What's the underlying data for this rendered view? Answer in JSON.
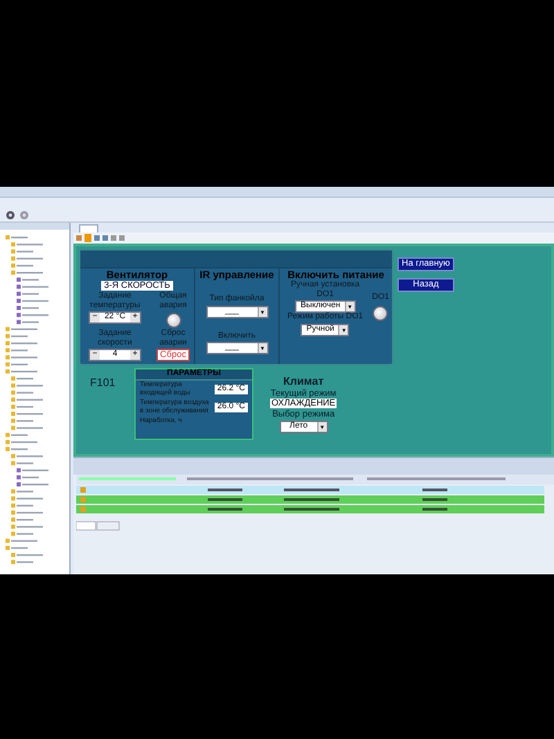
{
  "fan": {
    "title": "Вентилятор",
    "mode": "3-Я СКОРОСТЬ",
    "temp_label": "Задание температуры",
    "temp_value": "22 °C",
    "alarm_label": "Общая авария",
    "alarm_on": false,
    "speed_label": "Задание скорости",
    "speed_value": "4",
    "reset_label": "Сброс аварии",
    "reset_button": "Сброс",
    "minus": "−",
    "plus": "+"
  },
  "ir": {
    "title": "IR управление",
    "fields": [
      {
        "label": "Тип фанкойла",
        "value": "___"
      },
      {
        "label": "Включить",
        "value": "___"
      }
    ]
  },
  "power": {
    "title": "Включить питание",
    "manual_label": "Ручная установка DO1",
    "manual_value": "Выключен",
    "mode_label": "Режим работы DO1",
    "mode_value": "Ручной",
    "lamp_label": "DO1",
    "lamp_on": false
  },
  "nav": [
    {
      "label": "На главную"
    },
    {
      "label": "Назад"
    }
  ],
  "unit": "F101",
  "params": {
    "title": "ПАРАМЕТРЫ",
    "rows": [
      {
        "label": "Температура входящей воды",
        "value": "26.2 °C"
      },
      {
        "label": "Температура воздуха в зоне обслуживания",
        "value": "26.0 °C"
      },
      {
        "label": "Наработка, ч"
      }
    ]
  },
  "climate": {
    "title": "Климат",
    "mode_label": "Текущий режим",
    "mode_value": "ОХЛАЖДЕНИЕ",
    "select_label": "Выбор режима",
    "select_value": "Лето"
  },
  "arrow": "▼"
}
